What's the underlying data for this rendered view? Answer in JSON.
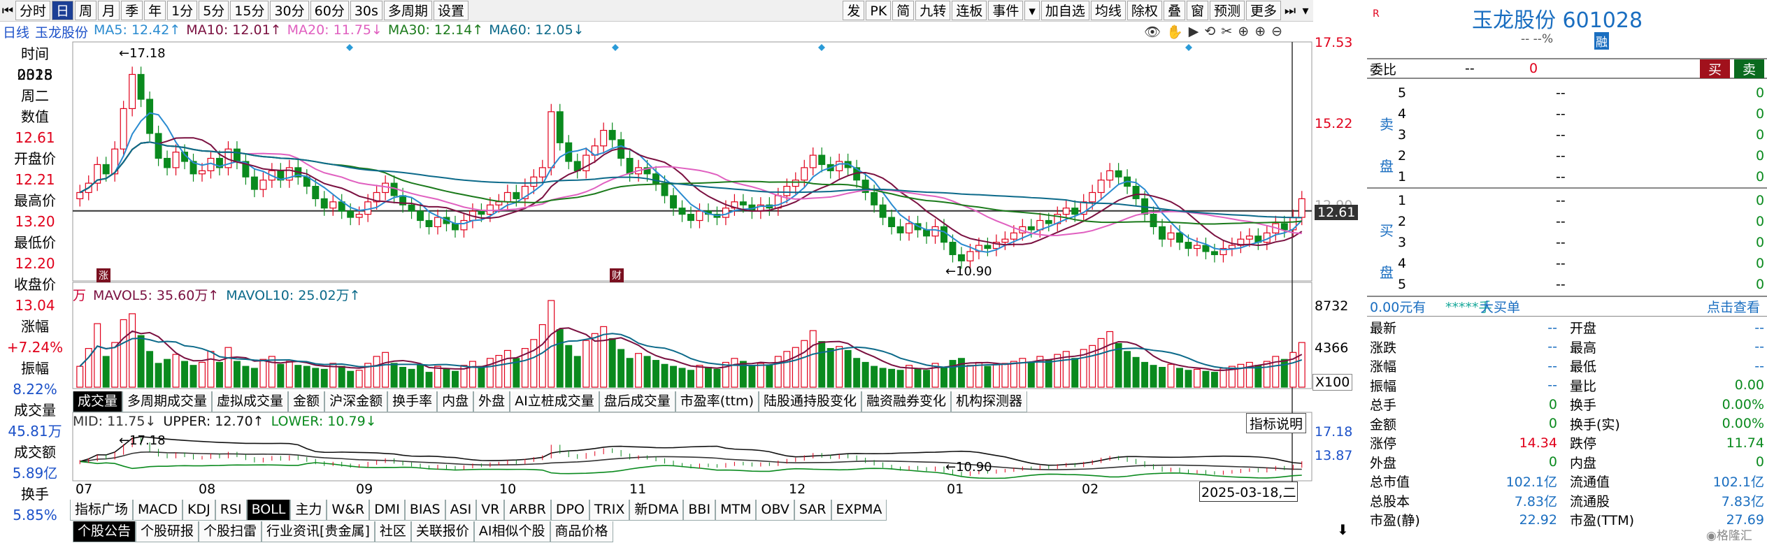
{
  "toolbar": {
    "periods": [
      "分时",
      "日",
      "周",
      "月",
      "季",
      "年",
      "1分",
      "5分",
      "15分",
      "30分",
      "60分",
      "30s"
    ],
    "selected": "日",
    "after": [
      "多周期",
      "设置"
    ],
    "right": [
      "发",
      "PK",
      "简",
      "九转",
      "连板",
      "事件",
      "▾",
      "加自选",
      "均线",
      "除权",
      "叠",
      "窗",
      "预测",
      "更多"
    ]
  },
  "left_info": [
    {
      "label": "时间",
      "value": "2025"
    },
    {
      "label": "",
      "value": "0318"
    },
    {
      "label": "",
      "value": "周二"
    },
    {
      "label": "数值",
      "value": "12.61"
    },
    {
      "label": "开盘价",
      "value": "12.21"
    },
    {
      "label": "最高价",
      "value": "13.20"
    },
    {
      "label": "最低价",
      "value": "12.20"
    },
    {
      "label": "收盘价",
      "value": "13.04"
    },
    {
      "label": "涨幅",
      "value": "+7.24%"
    },
    {
      "label": "振幅",
      "value": "8.22%"
    },
    {
      "label": "成交量",
      "value": "45.81万"
    },
    {
      "label": "成交额",
      "value": "5.89亿"
    },
    {
      "label": "换手",
      "value": "5.85%"
    }
  ],
  "ma_line": {
    "prefix": "日线",
    "name": "玉龙股份",
    "ma5": "MA5: 12.42↑",
    "ma10": "MA10: 12.01↑",
    "ma20": "MA20: 11.75↓",
    "ma30": "MA30: 12.14↑",
    "ma60": "MA60: 12.05↓"
  },
  "price_axis": [
    "17.53",
    "15.22",
    "12.61"
  ],
  "price_axis_hidden": "12.90",
  "price_hi_label": "17.18",
  "price_lo_label": "10.90",
  "vol_line": {
    "unit": "万",
    "mavol5": "MAVOL5: 35.60万↑",
    "mavol10": "MAVOL10: 25.02万↑"
  },
  "vol_axis": [
    "8732",
    "4366"
  ],
  "vol_scale": "X100",
  "ind_tabs": [
    "成交量",
    "多周期成交量",
    "虚拟成交量",
    "金额",
    "沪深金额",
    "换手率",
    "内盘",
    "外盘",
    "AI立桩成交量",
    "盘后成交量",
    "市盈率(ttm)",
    "陆股通持股变化",
    "融资融券变化",
    "机构探测器"
  ],
  "boll_line": {
    "mid": "MID: 11.75↓",
    "upper": "UPPER: 12.70↑",
    "lower": "LOWER: 10.79↓",
    "help": "指标说明"
  },
  "boll_axis": [
    "17.18",
    "13.87"
  ],
  "boll_hi": "17.18",
  "boll_lo": "10.90",
  "months": [
    "07",
    "08",
    "09",
    "10",
    "11",
    "12",
    "01",
    "02"
  ],
  "date_cursor": "2025-03-18,二",
  "indicator_tabs": [
    "指标广场",
    "MACD",
    "KDJ",
    "RSI",
    "BOLL",
    "主力",
    "W&R",
    "DMI",
    "BIAS",
    "ASI",
    "VR",
    "ARBR",
    "DPO",
    "TRIX",
    "新DMA",
    "BBI",
    "MTM",
    "OBV",
    "SAR",
    "EXPMA"
  ],
  "indicator_selected": "BOLL",
  "news_tabs": [
    "个股公告",
    "个股研报",
    "个股扫雷",
    "行业资讯[贵金属]",
    "社区",
    "关联报价",
    "AI相似个股",
    "商品价格"
  ],
  "panel": {
    "title": "玉龙股份 601028",
    "sub": "-- --%",
    "tag": "融",
    "weibi": "委比",
    "weibi_v1": "--",
    "weibi_v2": "0",
    "buy": "买",
    "sell": "卖",
    "sell_levels": [
      "5",
      "4",
      "3",
      "2",
      "1"
    ],
    "buy_levels": [
      "1",
      "2",
      "3",
      "4",
      "5"
    ],
    "sell_label": "卖盘",
    "buy_label": "买盘",
    "dash": "--",
    "zero": "0",
    "flow": "0.00元有",
    "flow2": "*****手",
    "flow3": "大买单",
    "flow4": "点击查看",
    "stats": [
      [
        "最新",
        "--",
        "开盘",
        "--"
      ],
      [
        "涨跌",
        "--",
        "最高",
        "--"
      ],
      [
        "涨幅",
        "--",
        "最低",
        "--"
      ],
      [
        "振幅",
        "--",
        "量比",
        "0.00"
      ],
      [
        "总手",
        "0",
        "换手",
        "0.00%"
      ],
      [
        "金额",
        "0",
        "换手(实)",
        "0.00%"
      ],
      [
        "涨停",
        "14.34",
        "跌停",
        "11.74"
      ],
      [
        "外盘",
        "0",
        "内盘",
        "0"
      ],
      [
        "总市值",
        "102.1亿",
        "流通值",
        "102.1亿"
      ],
      [
        "总股本",
        "7.83亿",
        "流通股",
        "7.83亿"
      ],
      [
        "市盈(静)",
        "22.92",
        "市盈(TTM)",
        "27.69"
      ]
    ]
  },
  "colors": {
    "up": "#e0001b",
    "down": "#0a8a1e",
    "ma5": "#2a8bd0",
    "ma10": "#7a1040",
    "ma20": "#e060c0",
    "ma30": "#1b7a1b",
    "ma60": "#0c6a8a"
  },
  "chart_data": {
    "type": "candlestick",
    "months": [
      "07",
      "08",
      "09",
      "10",
      "11",
      "12",
      "01",
      "02",
      "03"
    ],
    "hi": 17.18,
    "lo": 10.9,
    "current": 12.61,
    "closes": [
      13.2,
      13.5,
      14.1,
      13.8,
      14.6,
      15.9,
      17.0,
      16.2,
      15.1,
      14.3,
      14.0,
      14.5,
      14.2,
      13.8,
      13.9,
      14.3,
      14.0,
      14.6,
      14.2,
      13.7,
      13.3,
      13.6,
      13.9,
      13.6,
      14.0,
      13.7,
      13.4,
      13.0,
      12.7,
      12.9,
      12.6,
      12.4,
      12.5,
      12.9,
      13.2,
      13.5,
      13.1,
      12.8,
      12.6,
      12.3,
      12.1,
      12.4,
      12.2,
      12.0,
      12.3,
      12.6,
      12.5,
      12.8,
      12.9,
      13.2,
      13.0,
      13.4,
      13.7,
      14.0,
      15.8,
      14.8,
      14.2,
      13.9,
      14.4,
      14.7,
      15.2,
      14.9,
      14.3,
      13.8,
      14.0,
      13.8,
      13.5,
      13.1,
      12.7,
      12.5,
      12.3,
      12.6,
      12.5,
      12.4,
      12.7,
      12.9,
      12.8,
      12.6,
      12.8,
      12.7,
      13.1,
      13.4,
      13.6,
      14.0,
      14.4,
      14.1,
      13.9,
      14.2,
      14.0,
      13.6,
      13.2,
      12.8,
      12.4,
      12.1,
      11.9,
      12.2,
      12.0,
      11.8,
      12.1,
      11.6,
      11.2,
      11.0,
      11.3,
      11.5,
      11.4,
      11.6,
      11.7,
      11.9,
      12.1,
      12.0,
      12.3,
      12.2,
      12.5,
      12.7,
      12.5,
      12.9,
      13.2,
      13.6,
      13.9,
      13.7,
      13.4,
      13.0,
      12.5,
      12.1,
      11.7,
      11.9,
      11.6,
      11.4,
      11.5,
      11.3,
      11.2,
      11.4,
      11.5,
      11.7,
      11.8,
      11.6,
      11.9,
      12.2,
      12.0,
      12.4,
      13.0
    ],
    "volumes": [
      2100,
      3900,
      6400,
      3100,
      4500,
      6800,
      7400,
      5200,
      3600,
      2400,
      2800,
      3300,
      2600,
      2200,
      2500,
      3600,
      2500,
      4000,
      2600,
      2100,
      1900,
      2800,
      3100,
      2300,
      2600,
      2200,
      2100,
      1900,
      1800,
      2400,
      2100,
      1600,
      1700,
      2400,
      3100,
      3500,
      2400,
      2000,
      1800,
      2200,
      1500,
      2100,
      1800,
      1600,
      2200,
      2600,
      2100,
      2900,
      3200,
      3700,
      2900,
      3900,
      4800,
      6300,
      8732,
      5800,
      4200,
      3100,
      4700,
      5400,
      6100,
      4900,
      3800,
      2900,
      3400,
      3100,
      2700,
      2300,
      2100,
      1900,
      1700,
      2200,
      2000,
      1800,
      2500,
      2900,
      2600,
      2100,
      2400,
      2200,
      3100,
      3600,
      4000,
      4700,
      5700,
      4600,
      3900,
      4100,
      3700,
      2900,
      2500,
      2100,
      1900,
      1800,
      1700,
      2200,
      1800,
      1700,
      2400,
      2000,
      2700,
      2900,
      2200,
      2500,
      2100,
      2300,
      2400,
      2600,
      2900,
      2500,
      3100,
      2700,
      3300,
      3600,
      2900,
      3800,
      4200,
      4900,
      5600,
      4400,
      3600,
      3000,
      2500,
      2200,
      2000,
      2300,
      1900,
      1700,
      1800,
      1600,
      1500,
      1900,
      2100,
      2300,
      2500,
      2200,
      2600,
      3100,
      2800,
      3500,
      4500
    ]
  }
}
